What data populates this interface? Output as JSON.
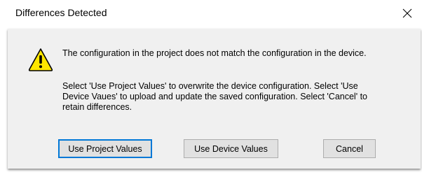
{
  "window": {
    "title": "Differences Detected",
    "close_icon": "close-icon"
  },
  "message": {
    "icon": "warning-icon",
    "line1": "The configuration in the project does not match the configuration in the device.",
    "line2": "Select 'Use Project Values' to overwrite the device configuration. Select 'Use Device Vaues' to upload and update the saved configuration. Select 'Cancel' to retain differences."
  },
  "buttons": {
    "project": "Use Project Values",
    "device": "Use Device Values",
    "cancel": "Cancel"
  },
  "colors": {
    "content_bg": "#f0f0f0",
    "button_bg": "#e1e1e1",
    "default_button_border": "#0078d7",
    "warning_fill": "#ffe600"
  }
}
